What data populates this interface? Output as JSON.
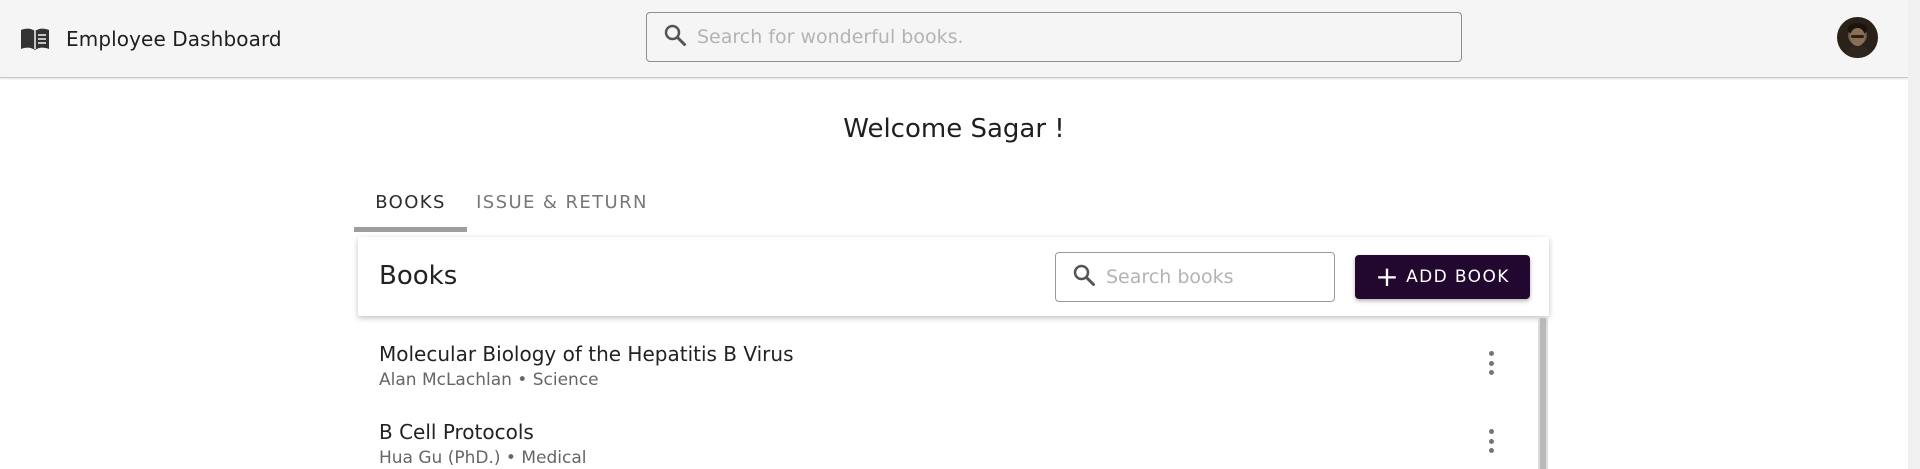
{
  "header": {
    "title": "Employee Dashboard",
    "logo_icon": "menu-book-icon",
    "search_placeholder": "Search for wonderful books.",
    "search_icon": "search-icon",
    "avatar_icon": "user-avatar"
  },
  "welcome": {
    "text": "Welcome Sagar !"
  },
  "tabs": [
    {
      "label": "BOOKS",
      "active": true
    },
    {
      "label": "ISSUE & RETURN",
      "active": false
    }
  ],
  "books_card": {
    "title": "Books",
    "search_placeholder": "Search books",
    "add_label": "ADD BOOK",
    "add_icon": "plus-icon"
  },
  "books": [
    {
      "title": "Molecular Biology of the Hepatitis B Virus",
      "meta": "Alan McLachlan • Science"
    },
    {
      "title": "B Cell Protocols",
      "meta": "Hua Gu (PhD.) • Medical"
    }
  ],
  "colors": {
    "appbar_bg": "#f5f5f5",
    "primary_button": "#22082e",
    "tab_indicator": "#9e9e9e"
  }
}
